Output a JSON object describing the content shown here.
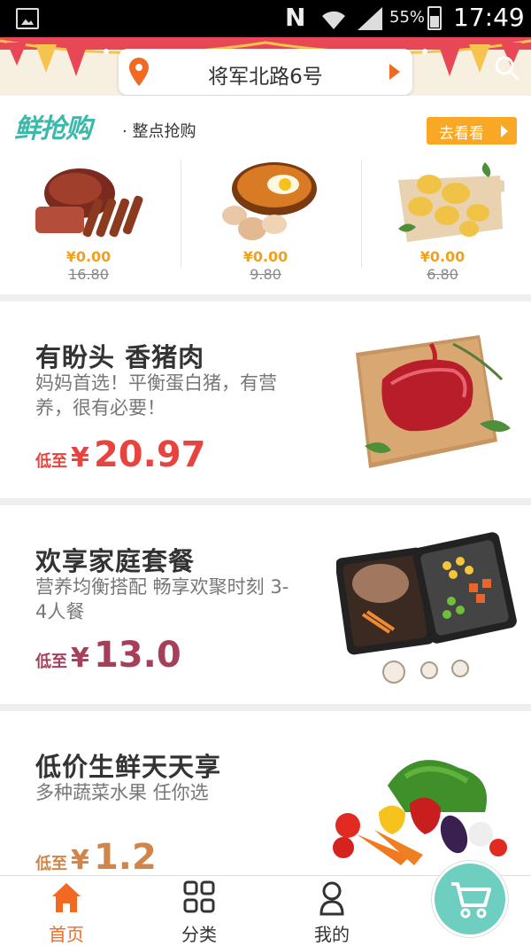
{
  "status_bar": {
    "carrier_icon": "N",
    "battery": "55%",
    "time": "17:49"
  },
  "header": {
    "location": "将军北路6号"
  },
  "flash_sale": {
    "logo": "鲜抢购",
    "subtitle": "· 整点抢购",
    "more_label": "去看看",
    "items": [
      {
        "price": "¥0.00",
        "original": "16.80"
      },
      {
        "price": "¥0.00",
        "original": "9.80"
      },
      {
        "price": "¥0.00",
        "original": "6.80"
      }
    ]
  },
  "promos": [
    {
      "title": "有盼头 香猪肉",
      "desc": "妈妈首选！平衡蛋白猪，有营养，很有必要！",
      "prefix": "低至",
      "yen": "¥",
      "price": "20.97",
      "color": "#e8433f"
    },
    {
      "title": "欢享家庭套餐",
      "desc": "营养均衡搭配 畅享欢聚时刻 3-4人餐",
      "prefix": "低至",
      "yen": "¥",
      "price": "13.0",
      "color": "#a6405a"
    },
    {
      "title": "低价生鲜天天享",
      "desc": "多种蔬菜水果 任你选",
      "prefix": "低至",
      "yen": "¥",
      "price": "1.2",
      "color": "#d0864a"
    }
  ],
  "nav": {
    "items": [
      {
        "label": "首页",
        "icon": "home-icon",
        "active": true
      },
      {
        "label": "分类",
        "icon": "grid-icon",
        "active": false
      },
      {
        "label": "我的",
        "icon": "user-icon",
        "active": false
      }
    ],
    "cart_icon": "cart-icon"
  },
  "colors": {
    "accent": "#f26a22",
    "teal": "#3cb9ab",
    "flash_price": "#f0a21c",
    "more_button": "#f9a826"
  }
}
